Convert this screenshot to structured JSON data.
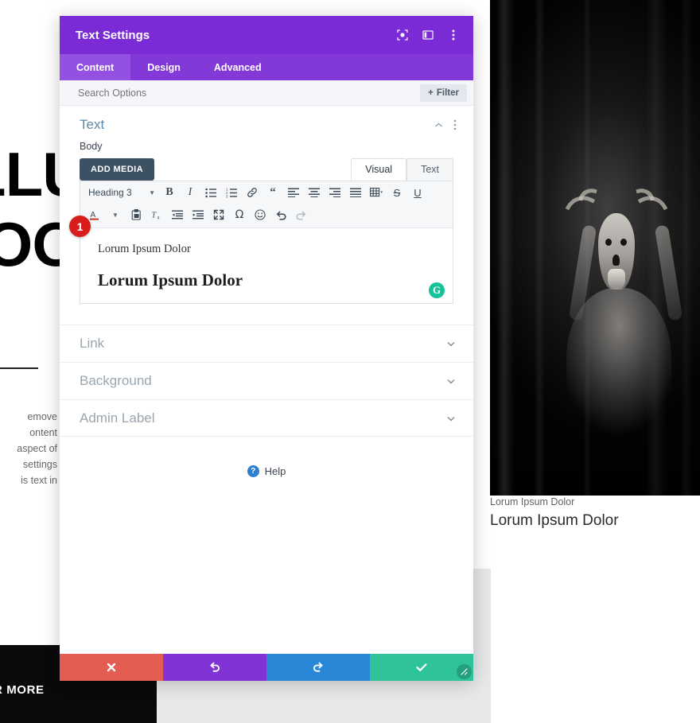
{
  "background_page": {
    "hero_line1": "LLU",
    "hero_line2": "IOO",
    "paragraph": "emove\nontent\naspect of\nsettings\nis text in",
    "more_label": "R MORE"
  },
  "photo": {
    "alt_name": "woman-holding-deer-skull-black-and-white",
    "caption_small": "Lorum Ipsum Dolor",
    "caption_large": "Lorum Ipsum Dolor"
  },
  "modal": {
    "title": "Text Settings",
    "header_icons": [
      {
        "name": "target-icon",
        "glyph": "target"
      },
      {
        "name": "layout-panel-icon",
        "glyph": "panel"
      },
      {
        "name": "more-vertical-icon",
        "glyph": "dots"
      }
    ],
    "tabs": [
      {
        "label": "Content",
        "active": true
      },
      {
        "label": "Design",
        "active": false
      },
      {
        "label": "Advanced",
        "active": false
      }
    ],
    "search": {
      "placeholder": "Search Options",
      "value": "",
      "filter_label": "Filter",
      "filter_plus": "+"
    },
    "section": {
      "title": "Text",
      "collapse_icon": "chevron-up-icon",
      "menu_icon": "more-vertical-icon"
    },
    "body_field": {
      "label": "Body",
      "add_media_label": "ADD MEDIA",
      "view_tabs": [
        {
          "label": "Visual",
          "active": true
        },
        {
          "label": "Text",
          "active": false
        }
      ],
      "format_select": "Heading 3",
      "toolbar_row1": [
        {
          "name": "bold-icon",
          "glyph": "B"
        },
        {
          "name": "italic-icon",
          "glyph": "I"
        },
        {
          "name": "bulleted-list-icon",
          "glyph": "ul"
        },
        {
          "name": "numbered-list-icon",
          "glyph": "ol"
        },
        {
          "name": "link-icon",
          "glyph": "link"
        },
        {
          "name": "blockquote-icon",
          "glyph": "quote"
        },
        {
          "name": "align-left-icon",
          "glyph": "alignleft"
        },
        {
          "name": "align-center-icon",
          "glyph": "aligncenter"
        },
        {
          "name": "align-right-icon",
          "glyph": "alignright"
        },
        {
          "name": "align-justify-icon",
          "glyph": "alignjustify"
        },
        {
          "name": "table-icon",
          "glyph": "table"
        },
        {
          "name": "strikethrough-icon",
          "glyph": "S"
        },
        {
          "name": "underline-icon",
          "glyph": "U"
        }
      ],
      "toolbar_row2": [
        {
          "name": "text-color-icon",
          "glyph": "A"
        },
        {
          "name": "paste-as-text-icon",
          "glyph": "paste"
        },
        {
          "name": "clear-formatting-icon",
          "glyph": "eraser"
        },
        {
          "name": "outdent-icon",
          "glyph": "outdent"
        },
        {
          "name": "indent-icon",
          "glyph": "indent"
        },
        {
          "name": "fullscreen-icon",
          "glyph": "expand"
        },
        {
          "name": "special-character-icon",
          "glyph": "omega"
        },
        {
          "name": "emoji-icon",
          "glyph": "smiley"
        },
        {
          "name": "undo-icon",
          "glyph": "undo"
        },
        {
          "name": "redo-icon",
          "glyph": "redo"
        }
      ],
      "content_line_1": "Lorum Ipsum Dolor",
      "content_line_2": "Lorum Ipsum Dolor",
      "grammarly_badge": "G",
      "step_badge": "1"
    },
    "accordion": [
      {
        "label": "Link"
      },
      {
        "label": "Background"
      },
      {
        "label": "Admin Label"
      }
    ],
    "help": {
      "icon_char": "?",
      "label": "Help"
    },
    "footer": [
      {
        "name": "cancel-button",
        "glyph": "x"
      },
      {
        "name": "undo-button",
        "glyph": "undo"
      },
      {
        "name": "redo-button",
        "glyph": "redo"
      },
      {
        "name": "save-button",
        "glyph": "check"
      }
    ],
    "resize_grip": "resize-handle"
  },
  "colors": {
    "header_purple": "#7b2bd6",
    "tab_purple": "#8338d8",
    "tab_active_purple": "#9450e0",
    "cancel_red": "#e45c52",
    "undo_purple": "#8233d6",
    "redo_blue": "#2a87d8",
    "save_green": "#2ec39a",
    "section_blue": "#5b8aa8",
    "badge_red": "#d91d1d",
    "grammarly_green": "#15c39a"
  }
}
